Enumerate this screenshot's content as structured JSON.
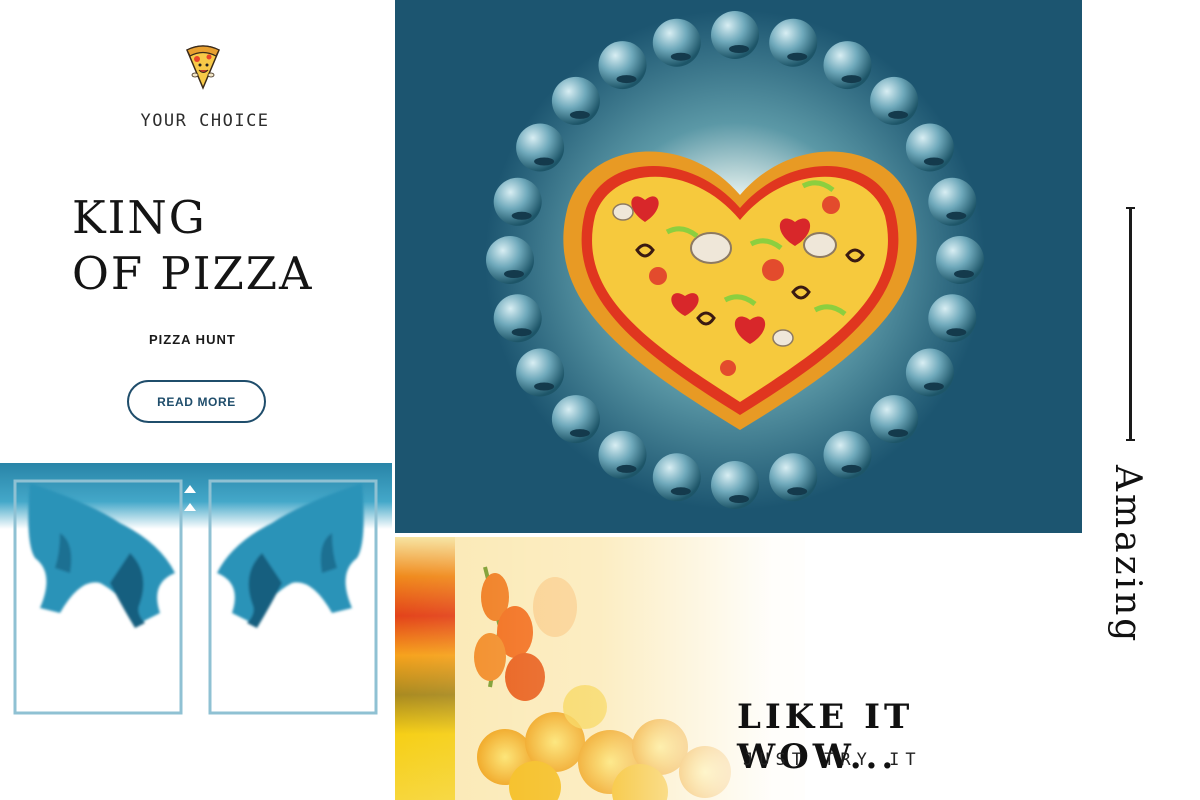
{
  "left_card": {
    "kicker": "YOUR CHOICE",
    "headline_line1": "KING",
    "headline_line2": "OF PIZZA",
    "brand": "PIZZA HUNT",
    "button_label": "READ MORE"
  },
  "flowers": {
    "tagline": "LIKE IT WOW...",
    "subline": "JUST TRY IT"
  },
  "vertical_word": "Amazing",
  "icons": [
    "pizza-slice-mascot-icon"
  ],
  "colors": {
    "accent": "#1f4d6b",
    "pizza_bg": "#1c5570",
    "ink_blue": "#2c8fb0",
    "frame": "#8fc1d3",
    "flower_orange": "#f08a1c",
    "flower_yellow": "#f6cf16"
  }
}
